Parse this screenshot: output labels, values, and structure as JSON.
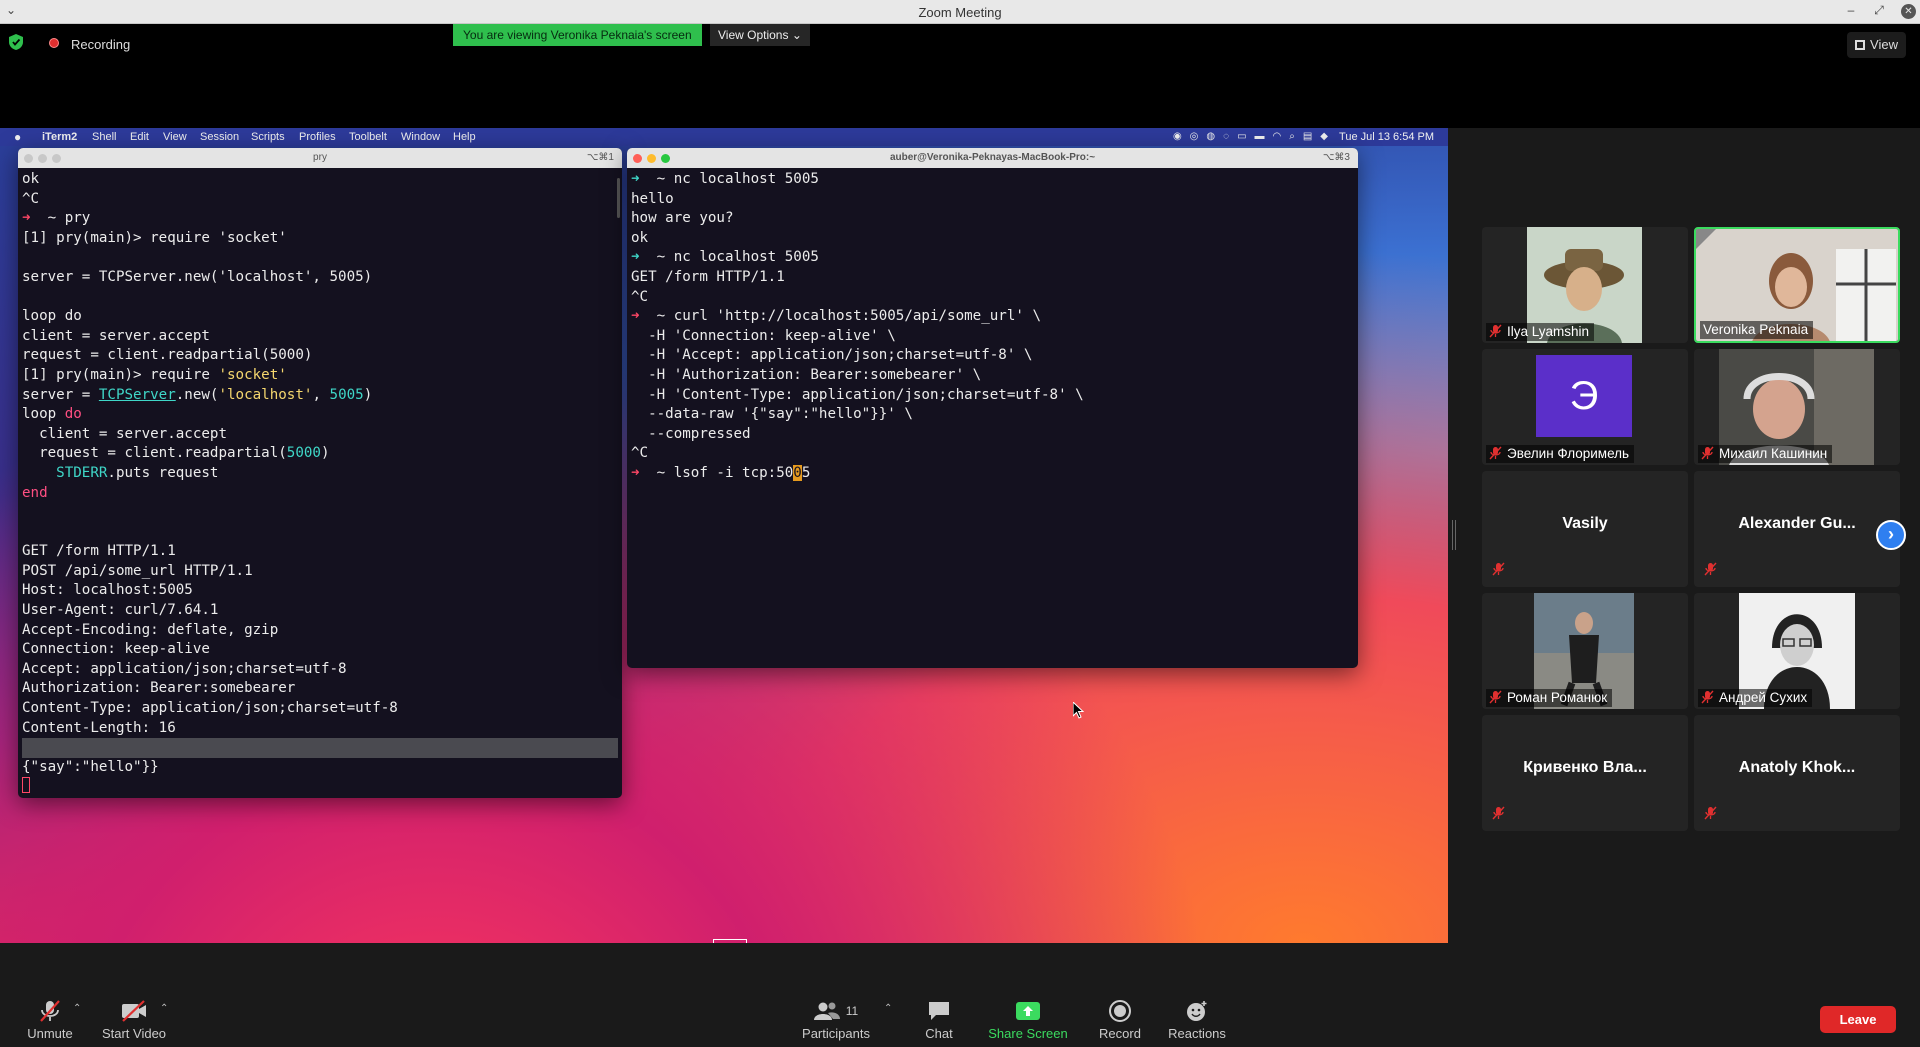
{
  "window": {
    "title": "Zoom Meeting"
  },
  "top_bar": {
    "recording_label": "Recording",
    "viewing_banner": "You are viewing Veronika Peknaia's screen",
    "view_options_label": "View Options",
    "view_label": "View"
  },
  "mac_menubar": {
    "items": [
      "iTerm2",
      "Shell",
      "Edit",
      "View",
      "Session",
      "Scripts",
      "Profiles",
      "Toolbelt",
      "Window",
      "Help"
    ],
    "clock": "Tue Jul 13  6:54 PM"
  },
  "terminal_left": {
    "title": "pry",
    "shortcut": "⌥⌘1",
    "lines": [
      "ok",
      "^C",
      "__PROMPT__ ~ pry",
      "[1] pry(main)> require 'socket'",
      "",
      "server = TCPServer.new('localhost', 5005)",
      "",
      "loop do",
      "client = server.accept",
      "request = client.readpartial(5000)",
      "__H1__",
      "__H2__",
      "__H3__",
      "__H4__",
      "__H5__",
      "__H6__",
      "__H7__",
      "",
      "",
      "GET /form HTTP/1.1",
      "POST /api/some_url HTTP/1.1",
      "Host: localhost:5005",
      "User-Agent: curl/7.64.1",
      "Accept-Encoding: deflate, gzip",
      "Connection: keep-alive",
      "Accept: application/json;charset=utf-8",
      "Authorization: Bearer:somebearer",
      "Content-Type: application/json;charset=utf-8",
      "Content-Length: 16",
      "__HL__",
      "{\"say\":\"hello\"}}",
      "__CURSOR__"
    ]
  },
  "terminal_right": {
    "title": "auber@Veronika-Peknayas-MacBook-Pro:~",
    "shortcut": "⌥⌘3",
    "lines": [
      "__PROMPT2__ ~ nc localhost 5005",
      "hello",
      "how are you?",
      "ok",
      "__PROMPT2__ ~ nc localhost 5005",
      "GET /form HTTP/1.1",
      "^C",
      "__PROMPT__ ~ curl 'http://localhost:5005/api/some_url' \\",
      "  -H 'Connection: keep-alive' \\",
      "  -H 'Accept: application/json;charset=utf-8' \\",
      "  -H 'Authorization: Bearer:somebearer' \\",
      "  -H 'Content-Type: application/json;charset=utf-8' \\",
      "  --data-raw '{\"say\":\"hello\"}}' \\",
      "  --compressed",
      "^C",
      "__LSOF__"
    ]
  },
  "highlighted_ruby": {
    "l1": "[1] pry(main)> require ",
    "l1_str": "'socket'",
    "l2_a": "server = ",
    "l2_cls": "TCPServer",
    "l2_b": ".new(",
    "l2_str": "'localhost'",
    "l2_c": ", ",
    "l2_num": "5005",
    "l2_d": ")",
    "l3_kw1": "loop",
    "l3_kw2": "do",
    "l4": "  client = server.accept",
    "l5_a": "  request = client.readpartial(",
    "l5_num": "5000",
    "l5_b": ")",
    "l6_const": "    STDERR",
    "l6_b": ".puts request",
    "l7_kw": "end",
    "lsof_a": "  ~ lsof -i tcp:50",
    "lsof_cur": "0",
    "lsof_b": "5",
    "prompt_glyph": "➜"
  },
  "participants": [
    {
      "name": "Ilya Lyamshin",
      "muted": true,
      "video": true,
      "active": false
    },
    {
      "name": "Veronika Peknaia",
      "muted": false,
      "video": true,
      "active": true
    },
    {
      "name": "Эвелин Флоримель",
      "muted": true,
      "video": false,
      "avatar_letter": "Э",
      "avatar_color": "#5b2fc9"
    },
    {
      "name": "Михаил Кашинин",
      "muted": true,
      "video": true
    },
    {
      "name": "Vasily",
      "muted": true,
      "video": false
    },
    {
      "name": "Alexander Gu...",
      "muted": true,
      "video": false
    },
    {
      "name": "Роман Романюк",
      "muted": true,
      "video": true
    },
    {
      "name": "Андрей Сухих",
      "muted": true,
      "video": true
    },
    {
      "name": "Кривенко Вла...",
      "muted": true,
      "video": false
    },
    {
      "name": "Anatoly Khok...",
      "muted": true,
      "video": false
    }
  ],
  "toolbar": {
    "unmute": "Unmute",
    "start_video": "Start Video",
    "participants": "Participants",
    "participants_count": "11",
    "chat": "Chat",
    "share_screen": "Share Screen",
    "record": "Record",
    "reactions": "Reactions",
    "leave": "Leave"
  },
  "colors": {
    "banner_green": "#2fbf4d",
    "active_border": "#3bdb5f",
    "leave_red": "#e02828",
    "prompt_red": "#ff4766",
    "prompt_teal": "#3fd7c8"
  }
}
